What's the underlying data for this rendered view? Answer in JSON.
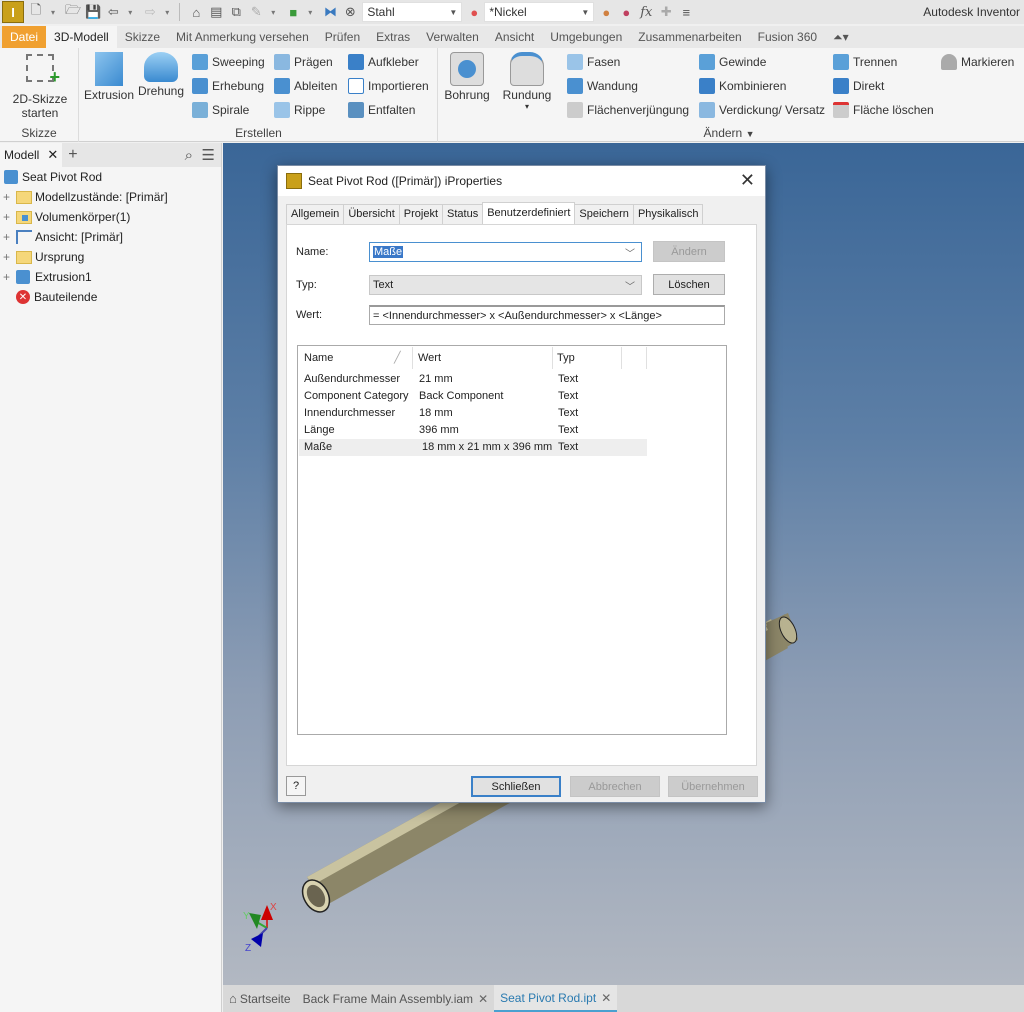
{
  "app": {
    "title": "Autodesk Inventor"
  },
  "qat": {
    "material": "Stahl",
    "appearance": "*Nickel",
    "icons": [
      "inventor-logo",
      "new-icon",
      "open-icon",
      "save-icon",
      "undo-icon",
      "redo-icon",
      "home-icon",
      "properties-icon",
      "window-icon",
      "sketch-icon",
      "select-icon",
      "link-icon",
      "material-icon",
      "appearance-icon",
      "adjust-icon",
      "clear-icon",
      "fx-icon",
      "plus-icon",
      "customize-icon"
    ]
  },
  "ribbon_tabs": [
    "Datei",
    "3D-Modell",
    "Skizze",
    "Mit Anmerkung versehen",
    "Prüfen",
    "Extras",
    "Verwalten",
    "Ansicht",
    "Umgebungen",
    "Zusammenarbeiten",
    "Fusion 360"
  ],
  "ribbon": {
    "skizze": {
      "label": "Skizze",
      "button": "2D-Skizze starten",
      "button_l1": "2D-Skizze",
      "button_l2": "starten"
    },
    "erstellen": {
      "label": "Erstellen",
      "big": [
        "Extrusion",
        "Drehung"
      ],
      "col1": [
        "Sweeping",
        "Erhebung",
        "Spirale"
      ],
      "col2": [
        "Prägen",
        "Ableiten",
        "Rippe"
      ],
      "col3": [
        "Aufkleber",
        "Importieren",
        "Entfalten"
      ]
    },
    "aendern": {
      "label": "Ändern",
      "big": [
        "Bohrung",
        "Rundung"
      ],
      "col1": [
        "Fasen",
        "Wandung",
        "Flächenverjüngung"
      ],
      "col2": [
        "Gewinde",
        "Kombinieren",
        "Verdickung/ Versatz"
      ],
      "col3": [
        "Trennen",
        "Direkt",
        "Fläche löschen"
      ],
      "extra": "Markieren"
    }
  },
  "browser": {
    "tab": "Modell",
    "root": "Seat Pivot Rod",
    "nodes": [
      "Modellzustände: [Primär]",
      "Volumenkörper(1)",
      "Ansicht: [Primär]",
      "Ursprung",
      "Extrusion1",
      "Bauteilende"
    ]
  },
  "doc_tabs": {
    "home": "Startseite",
    "tabs": [
      "Back Frame Main Assembly.iam",
      "Seat Pivot Rod.ipt"
    ],
    "active": "Seat Pivot Rod.ipt"
  },
  "viewcube_axes": [
    "X",
    "Y",
    "Z"
  ],
  "dialog": {
    "title": "Seat Pivot Rod ([Primär]) iProperties",
    "tabs": [
      "Allgemein",
      "Übersicht",
      "Projekt",
      "Status",
      "Benutzerdefiniert",
      "Speichern",
      "Physikalisch"
    ],
    "active_tab": "Benutzerdefiniert",
    "name_label": "Name:",
    "name_value": "Maße",
    "type_label": "Typ:",
    "type_value": "Text",
    "value_label": "Wert:",
    "value_value": "= <Innendurchmesser> x <Außendurchmesser> x <Länge>",
    "btn_change": "Ändern",
    "btn_delete": "Löschen",
    "columns": [
      "Name",
      "Wert",
      "Typ"
    ],
    "rows": [
      {
        "name": "Außendurchmesser",
        "value": "21 mm",
        "type": "Text"
      },
      {
        "name": "Component Category",
        "value": "Back Component",
        "type": "Text"
      },
      {
        "name": "Innendurchmesser",
        "value": "18 mm",
        "type": "Text"
      },
      {
        "name": "Länge",
        "value": "396 mm",
        "type": "Text"
      },
      {
        "name": "Maße",
        "value": "18 mm x 21 mm x 396 mm",
        "type": "Text"
      }
    ],
    "selected_row": "Maße",
    "btn_close": "Schließen",
    "btn_cancel": "Abbrechen",
    "btn_apply": "Übernehmen"
  }
}
